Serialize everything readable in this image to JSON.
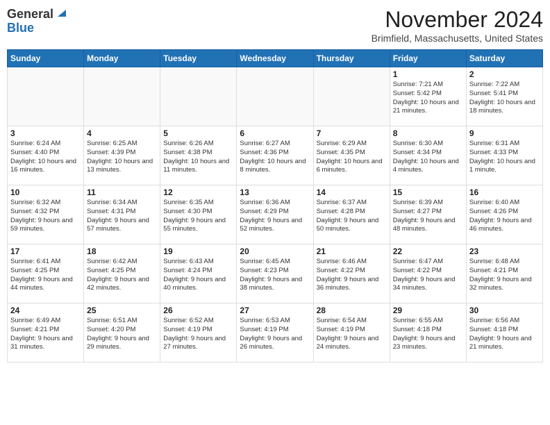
{
  "logo": {
    "general": "General",
    "blue": "Blue"
  },
  "header": {
    "month": "November 2024",
    "location": "Brimfield, Massachusetts, United States"
  },
  "weekdays": [
    "Sunday",
    "Monday",
    "Tuesday",
    "Wednesday",
    "Thursday",
    "Friday",
    "Saturday"
  ],
  "weeks": [
    [
      {
        "day": "",
        "info": ""
      },
      {
        "day": "",
        "info": ""
      },
      {
        "day": "",
        "info": ""
      },
      {
        "day": "",
        "info": ""
      },
      {
        "day": "",
        "info": ""
      },
      {
        "day": "1",
        "info": "Sunrise: 7:21 AM\nSunset: 5:42 PM\nDaylight: 10 hours and 21 minutes."
      },
      {
        "day": "2",
        "info": "Sunrise: 7:22 AM\nSunset: 5:41 PM\nDaylight: 10 hours and 18 minutes."
      }
    ],
    [
      {
        "day": "3",
        "info": "Sunrise: 6:24 AM\nSunset: 4:40 PM\nDaylight: 10 hours and 16 minutes."
      },
      {
        "day": "4",
        "info": "Sunrise: 6:25 AM\nSunset: 4:39 PM\nDaylight: 10 hours and 13 minutes."
      },
      {
        "day": "5",
        "info": "Sunrise: 6:26 AM\nSunset: 4:38 PM\nDaylight: 10 hours and 11 minutes."
      },
      {
        "day": "6",
        "info": "Sunrise: 6:27 AM\nSunset: 4:36 PM\nDaylight: 10 hours and 8 minutes."
      },
      {
        "day": "7",
        "info": "Sunrise: 6:29 AM\nSunset: 4:35 PM\nDaylight: 10 hours and 6 minutes."
      },
      {
        "day": "8",
        "info": "Sunrise: 6:30 AM\nSunset: 4:34 PM\nDaylight: 10 hours and 4 minutes."
      },
      {
        "day": "9",
        "info": "Sunrise: 6:31 AM\nSunset: 4:33 PM\nDaylight: 10 hours and 1 minute."
      }
    ],
    [
      {
        "day": "10",
        "info": "Sunrise: 6:32 AM\nSunset: 4:32 PM\nDaylight: 9 hours and 59 minutes."
      },
      {
        "day": "11",
        "info": "Sunrise: 6:34 AM\nSunset: 4:31 PM\nDaylight: 9 hours and 57 minutes."
      },
      {
        "day": "12",
        "info": "Sunrise: 6:35 AM\nSunset: 4:30 PM\nDaylight: 9 hours and 55 minutes."
      },
      {
        "day": "13",
        "info": "Sunrise: 6:36 AM\nSunset: 4:29 PM\nDaylight: 9 hours and 52 minutes."
      },
      {
        "day": "14",
        "info": "Sunrise: 6:37 AM\nSunset: 4:28 PM\nDaylight: 9 hours and 50 minutes."
      },
      {
        "day": "15",
        "info": "Sunrise: 6:39 AM\nSunset: 4:27 PM\nDaylight: 9 hours and 48 minutes."
      },
      {
        "day": "16",
        "info": "Sunrise: 6:40 AM\nSunset: 4:26 PM\nDaylight: 9 hours and 46 minutes."
      }
    ],
    [
      {
        "day": "17",
        "info": "Sunrise: 6:41 AM\nSunset: 4:25 PM\nDaylight: 9 hours and 44 minutes."
      },
      {
        "day": "18",
        "info": "Sunrise: 6:42 AM\nSunset: 4:25 PM\nDaylight: 9 hours and 42 minutes."
      },
      {
        "day": "19",
        "info": "Sunrise: 6:43 AM\nSunset: 4:24 PM\nDaylight: 9 hours and 40 minutes."
      },
      {
        "day": "20",
        "info": "Sunrise: 6:45 AM\nSunset: 4:23 PM\nDaylight: 9 hours and 38 minutes."
      },
      {
        "day": "21",
        "info": "Sunrise: 6:46 AM\nSunset: 4:22 PM\nDaylight: 9 hours and 36 minutes."
      },
      {
        "day": "22",
        "info": "Sunrise: 6:47 AM\nSunset: 4:22 PM\nDaylight: 9 hours and 34 minutes."
      },
      {
        "day": "23",
        "info": "Sunrise: 6:48 AM\nSunset: 4:21 PM\nDaylight: 9 hours and 32 minutes."
      }
    ],
    [
      {
        "day": "24",
        "info": "Sunrise: 6:49 AM\nSunset: 4:21 PM\nDaylight: 9 hours and 31 minutes."
      },
      {
        "day": "25",
        "info": "Sunrise: 6:51 AM\nSunset: 4:20 PM\nDaylight: 9 hours and 29 minutes."
      },
      {
        "day": "26",
        "info": "Sunrise: 6:52 AM\nSunset: 4:19 PM\nDaylight: 9 hours and 27 minutes."
      },
      {
        "day": "27",
        "info": "Sunrise: 6:53 AM\nSunset: 4:19 PM\nDaylight: 9 hours and 26 minutes."
      },
      {
        "day": "28",
        "info": "Sunrise: 6:54 AM\nSunset: 4:19 PM\nDaylight: 9 hours and 24 minutes."
      },
      {
        "day": "29",
        "info": "Sunrise: 6:55 AM\nSunset: 4:18 PM\nDaylight: 9 hours and 23 minutes."
      },
      {
        "day": "30",
        "info": "Sunrise: 6:56 AM\nSunset: 4:18 PM\nDaylight: 9 hours and 21 minutes."
      }
    ]
  ]
}
